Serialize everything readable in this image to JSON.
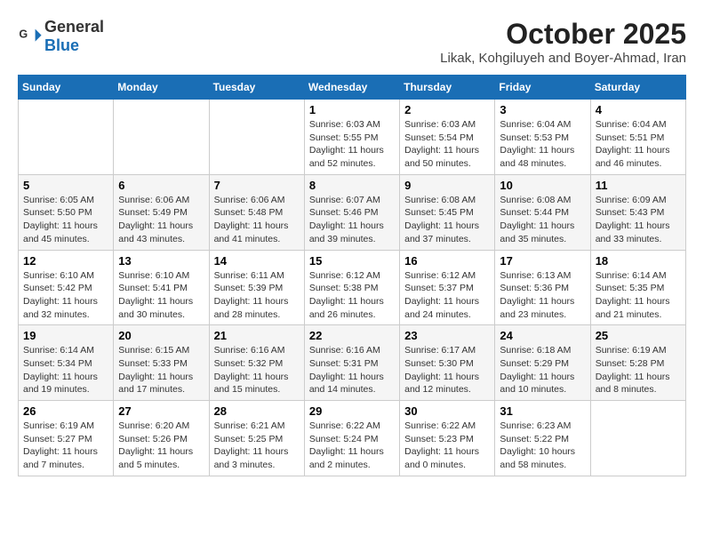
{
  "header": {
    "logo_general": "General",
    "logo_blue": "Blue",
    "month": "October 2025",
    "location": "Likak, Kohgiluyeh and Boyer-Ahmad, Iran"
  },
  "weekdays": [
    "Sunday",
    "Monday",
    "Tuesday",
    "Wednesday",
    "Thursday",
    "Friday",
    "Saturday"
  ],
  "weeks": [
    [
      {
        "day": "",
        "info": ""
      },
      {
        "day": "",
        "info": ""
      },
      {
        "day": "",
        "info": ""
      },
      {
        "day": "1",
        "info": "Sunrise: 6:03 AM\nSunset: 5:55 PM\nDaylight: 11 hours\nand 52 minutes."
      },
      {
        "day": "2",
        "info": "Sunrise: 6:03 AM\nSunset: 5:54 PM\nDaylight: 11 hours\nand 50 minutes."
      },
      {
        "day": "3",
        "info": "Sunrise: 6:04 AM\nSunset: 5:53 PM\nDaylight: 11 hours\nand 48 minutes."
      },
      {
        "day": "4",
        "info": "Sunrise: 6:04 AM\nSunset: 5:51 PM\nDaylight: 11 hours\nand 46 minutes."
      }
    ],
    [
      {
        "day": "5",
        "info": "Sunrise: 6:05 AM\nSunset: 5:50 PM\nDaylight: 11 hours\nand 45 minutes."
      },
      {
        "day": "6",
        "info": "Sunrise: 6:06 AM\nSunset: 5:49 PM\nDaylight: 11 hours\nand 43 minutes."
      },
      {
        "day": "7",
        "info": "Sunrise: 6:06 AM\nSunset: 5:48 PM\nDaylight: 11 hours\nand 41 minutes."
      },
      {
        "day": "8",
        "info": "Sunrise: 6:07 AM\nSunset: 5:46 PM\nDaylight: 11 hours\nand 39 minutes."
      },
      {
        "day": "9",
        "info": "Sunrise: 6:08 AM\nSunset: 5:45 PM\nDaylight: 11 hours\nand 37 minutes."
      },
      {
        "day": "10",
        "info": "Sunrise: 6:08 AM\nSunset: 5:44 PM\nDaylight: 11 hours\nand 35 minutes."
      },
      {
        "day": "11",
        "info": "Sunrise: 6:09 AM\nSunset: 5:43 PM\nDaylight: 11 hours\nand 33 minutes."
      }
    ],
    [
      {
        "day": "12",
        "info": "Sunrise: 6:10 AM\nSunset: 5:42 PM\nDaylight: 11 hours\nand 32 minutes."
      },
      {
        "day": "13",
        "info": "Sunrise: 6:10 AM\nSunset: 5:41 PM\nDaylight: 11 hours\nand 30 minutes."
      },
      {
        "day": "14",
        "info": "Sunrise: 6:11 AM\nSunset: 5:39 PM\nDaylight: 11 hours\nand 28 minutes."
      },
      {
        "day": "15",
        "info": "Sunrise: 6:12 AM\nSunset: 5:38 PM\nDaylight: 11 hours\nand 26 minutes."
      },
      {
        "day": "16",
        "info": "Sunrise: 6:12 AM\nSunset: 5:37 PM\nDaylight: 11 hours\nand 24 minutes."
      },
      {
        "day": "17",
        "info": "Sunrise: 6:13 AM\nSunset: 5:36 PM\nDaylight: 11 hours\nand 23 minutes."
      },
      {
        "day": "18",
        "info": "Sunrise: 6:14 AM\nSunset: 5:35 PM\nDaylight: 11 hours\nand 21 minutes."
      }
    ],
    [
      {
        "day": "19",
        "info": "Sunrise: 6:14 AM\nSunset: 5:34 PM\nDaylight: 11 hours\nand 19 minutes."
      },
      {
        "day": "20",
        "info": "Sunrise: 6:15 AM\nSunset: 5:33 PM\nDaylight: 11 hours\nand 17 minutes."
      },
      {
        "day": "21",
        "info": "Sunrise: 6:16 AM\nSunset: 5:32 PM\nDaylight: 11 hours\nand 15 minutes."
      },
      {
        "day": "22",
        "info": "Sunrise: 6:16 AM\nSunset: 5:31 PM\nDaylight: 11 hours\nand 14 minutes."
      },
      {
        "day": "23",
        "info": "Sunrise: 6:17 AM\nSunset: 5:30 PM\nDaylight: 11 hours\nand 12 minutes."
      },
      {
        "day": "24",
        "info": "Sunrise: 6:18 AM\nSunset: 5:29 PM\nDaylight: 11 hours\nand 10 minutes."
      },
      {
        "day": "25",
        "info": "Sunrise: 6:19 AM\nSunset: 5:28 PM\nDaylight: 11 hours\nand 8 minutes."
      }
    ],
    [
      {
        "day": "26",
        "info": "Sunrise: 6:19 AM\nSunset: 5:27 PM\nDaylight: 11 hours\nand 7 minutes."
      },
      {
        "day": "27",
        "info": "Sunrise: 6:20 AM\nSunset: 5:26 PM\nDaylight: 11 hours\nand 5 minutes."
      },
      {
        "day": "28",
        "info": "Sunrise: 6:21 AM\nSunset: 5:25 PM\nDaylight: 11 hours\nand 3 minutes."
      },
      {
        "day": "29",
        "info": "Sunrise: 6:22 AM\nSunset: 5:24 PM\nDaylight: 11 hours\nand 2 minutes."
      },
      {
        "day": "30",
        "info": "Sunrise: 6:22 AM\nSunset: 5:23 PM\nDaylight: 11 hours\nand 0 minutes."
      },
      {
        "day": "31",
        "info": "Sunrise: 6:23 AM\nSunset: 5:22 PM\nDaylight: 10 hours\nand 58 minutes."
      },
      {
        "day": "",
        "info": ""
      }
    ]
  ]
}
